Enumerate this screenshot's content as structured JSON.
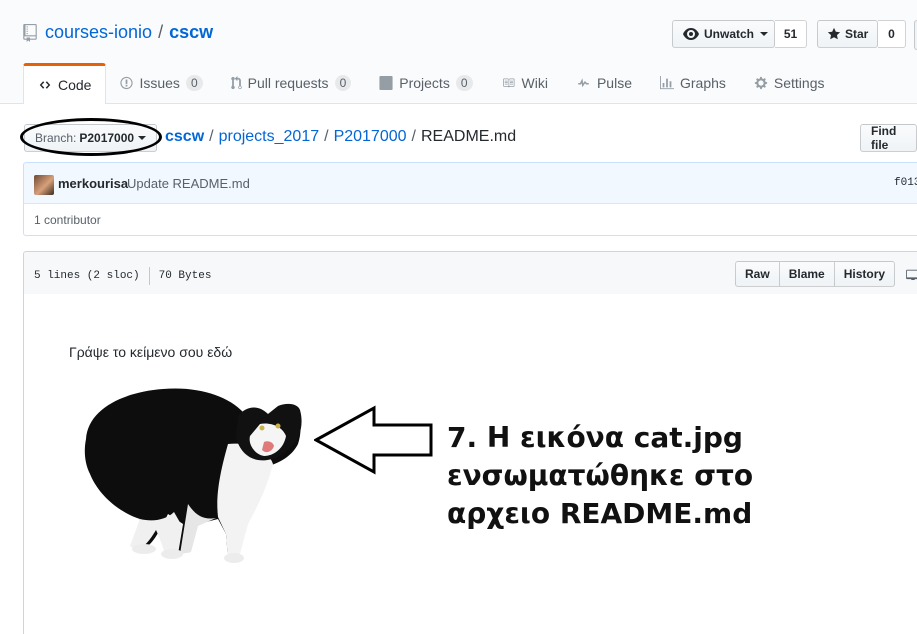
{
  "repo": {
    "owner": "courses-ionio",
    "separator": "/",
    "name": "cscw"
  },
  "actions": {
    "watch_label": "Unwatch",
    "watch_count": "51",
    "star_label": "Star",
    "star_count": "0"
  },
  "tabs": [
    {
      "label": "Code"
    },
    {
      "label": "Issues",
      "count": "0"
    },
    {
      "label": "Pull requests",
      "count": "0"
    },
    {
      "label": "Projects",
      "count": "0"
    },
    {
      "label": "Wiki"
    },
    {
      "label": "Pulse"
    },
    {
      "label": "Graphs"
    },
    {
      "label": "Settings"
    }
  ],
  "branch": {
    "label": "Branch:",
    "value": "P2017000"
  },
  "breadcrumb": {
    "root": "cscw",
    "parts": [
      "projects_2017",
      "P2017000"
    ],
    "file": "README.md",
    "sep": "/"
  },
  "find_file_label": "Find file",
  "commit": {
    "author": "merkourisa",
    "message": "Update README.md",
    "sha": "f013"
  },
  "contributors_text": "1 contributor",
  "file": {
    "lines": "5 lines (2 sloc)",
    "size": "70 Bytes",
    "buttons": {
      "raw": "Raw",
      "blame": "Blame",
      "history": "History"
    }
  },
  "readme": {
    "text": "Γράψε το κείμενο σου εδώ"
  },
  "annotation": {
    "lines": [
      "7. Η εικόνα cat.jpg",
      "ενσωματώθηκε στο",
      "αρχειο README.md"
    ]
  },
  "icons": [
    "repo-icon",
    "eye-icon",
    "star-icon",
    "code-icon",
    "issue-icon",
    "pull-request-icon",
    "project-icon",
    "book-icon",
    "pulse-icon",
    "graph-icon",
    "gear-icon",
    "desktop-icon"
  ],
  "colors": {
    "link": "#0366d6",
    "tab_accent": "#e36209",
    "commit_bg": "#f1f8ff"
  }
}
